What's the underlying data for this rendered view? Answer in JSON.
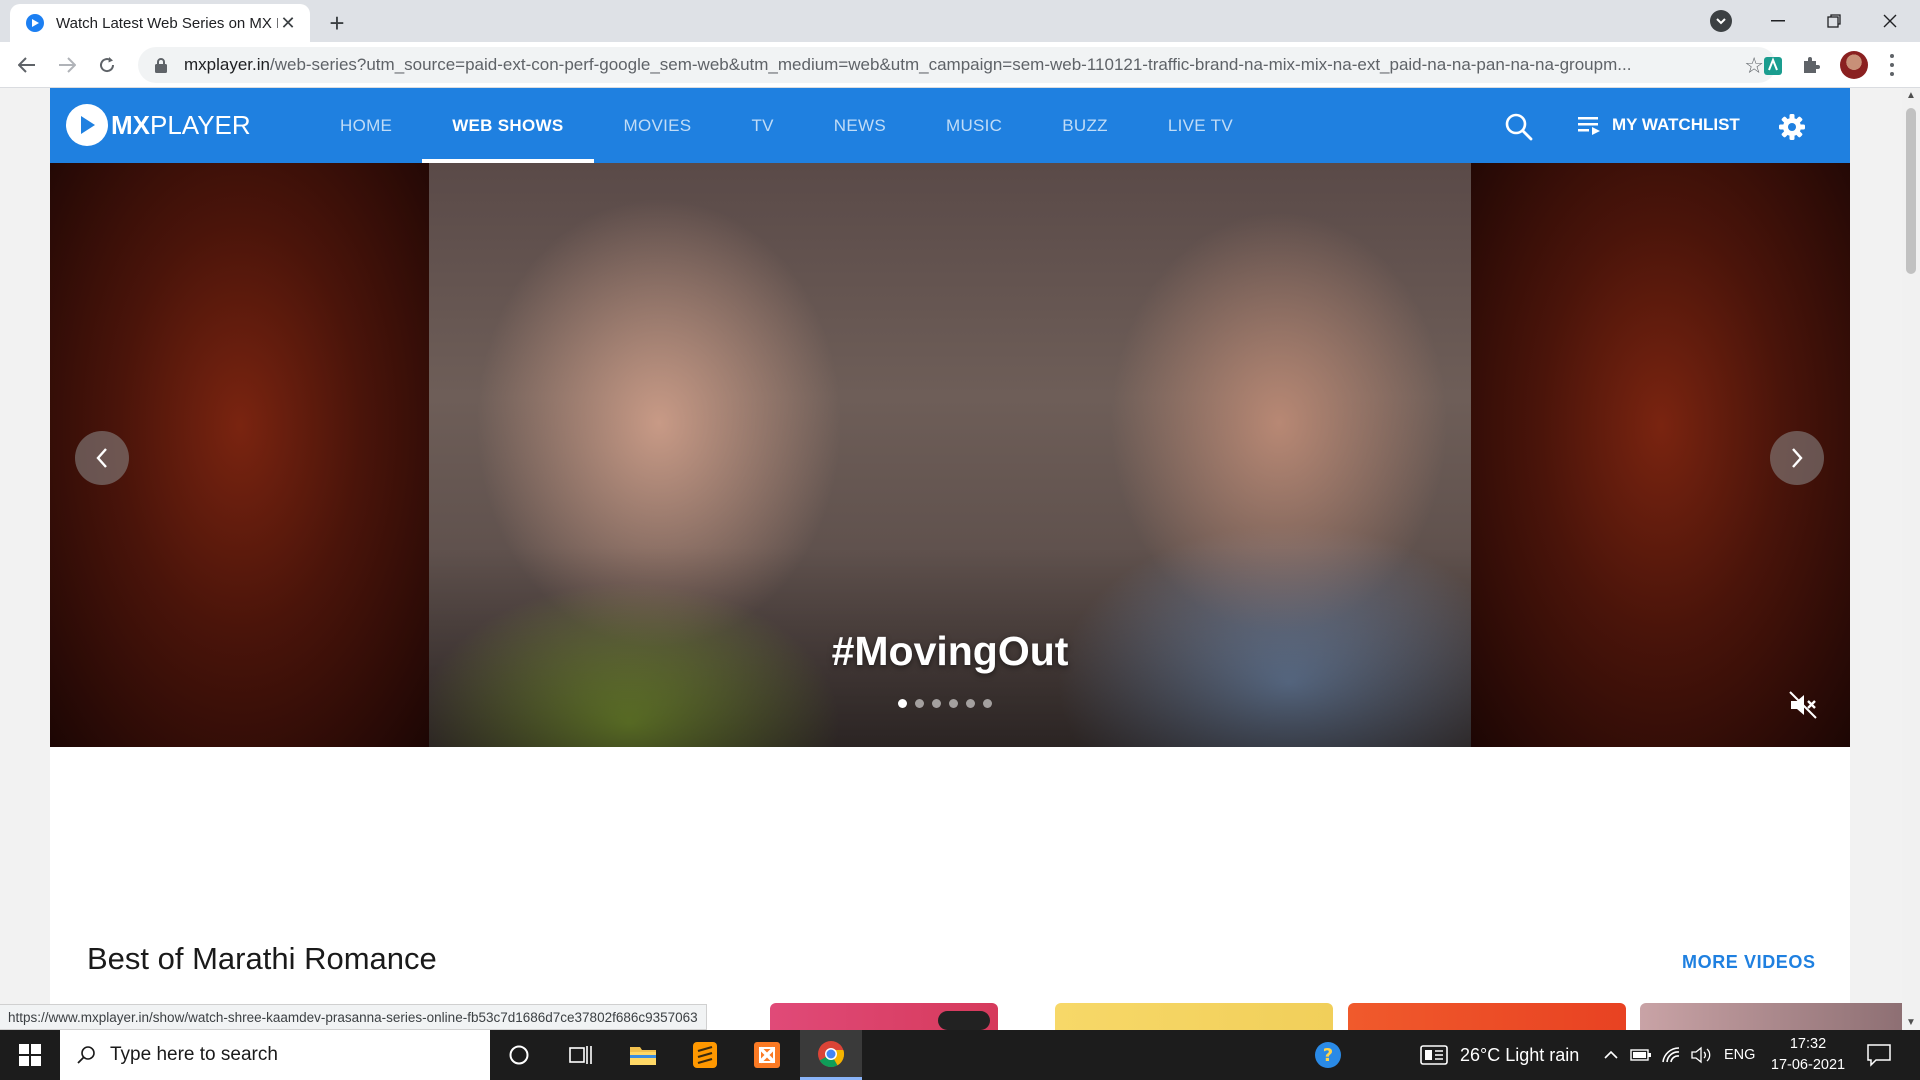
{
  "browser": {
    "tab": {
      "title": "Watch Latest Web Series on MX Player",
      "favicon": "mx-player-icon"
    },
    "address": {
      "domain": "mxplayer.in",
      "path": "/web-series?utm_source=paid-ext-con-perf-google_sem-web&utm_medium=web&utm_campaign=sem-web-110121-traffic-brand-na-mix-mix-na-ext_paid-na-na-pan-na-na-groupm..."
    },
    "status_url": "https://www.mxplayer.in/show/watch-shree-kaamdev-prasanna-series-online-fb53c7d1686d7ce37802f686c9357063"
  },
  "site": {
    "logo": {
      "bold": "MX",
      "light": "PLAYER"
    },
    "nav": [
      {
        "label": "HOME",
        "active": false
      },
      {
        "label": "WEB SHOWS",
        "active": true
      },
      {
        "label": "MOVIES",
        "active": false
      },
      {
        "label": "TV",
        "active": false
      },
      {
        "label": "NEWS",
        "active": false
      },
      {
        "label": "MUSIC",
        "active": false
      },
      {
        "label": "BUZZ",
        "active": false
      },
      {
        "label": "LIVE TV",
        "active": false
      }
    ],
    "watchlist_label": "MY WATCHLIST",
    "accent_color": "#1f80e0"
  },
  "hero": {
    "title": "#MovingOut",
    "slide_count": 6,
    "active_slide": 1
  },
  "rows": [
    {
      "title": "Best of Marathi Romance",
      "more_label": "MORE VIDEOS"
    }
  ],
  "taskbar": {
    "search_placeholder": "Type here to search",
    "weather": "26°C  Light rain",
    "language": "ENG",
    "time": "17:32",
    "date": "17-06-2021"
  }
}
